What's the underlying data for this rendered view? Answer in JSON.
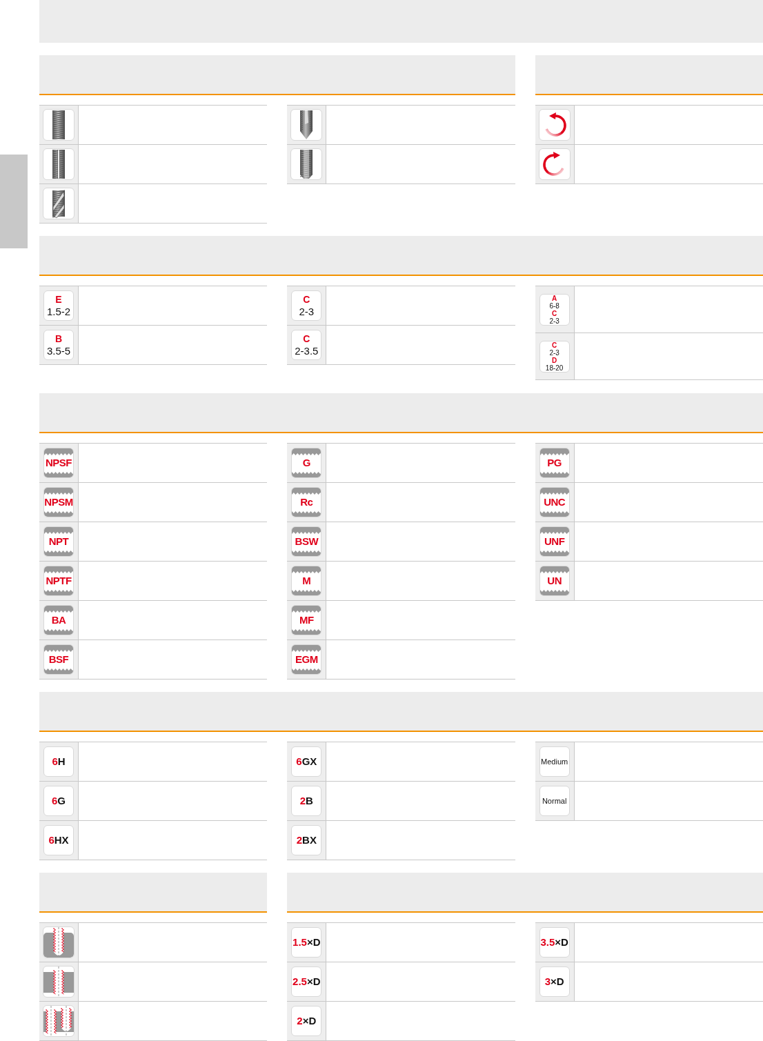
{
  "sections": [
    {
      "groups": [
        {
          "columns": [
            [
              {
                "kind": "straight"
              },
              {
                "kind": "fluted"
              },
              {
                "kind": "spiral"
              }
            ],
            [
              {
                "kind": "point"
              },
              {
                "kind": "forming"
              }
            ]
          ]
        },
        {
          "columns": [
            [
              {
                "kind": "ccw"
              },
              {
                "kind": "cw"
              }
            ]
          ]
        }
      ]
    },
    {
      "groups": [
        {
          "columns": [
            [
              {
                "kind": "chamfer",
                "lines": [
                  {
                    "text": "E",
                    "accent": true
                  },
                  {
                    "text": "1.5-2",
                    "accent": false
                  }
                ]
              },
              {
                "kind": "chamfer",
                "lines": [
                  {
                    "text": "B",
                    "accent": true
                  },
                  {
                    "text": "3.5-5",
                    "accent": false
                  }
                ]
              }
            ],
            [
              {
                "kind": "chamfer",
                "lines": [
                  {
                    "text": "C",
                    "accent": true
                  },
                  {
                    "text": "2-3",
                    "accent": false
                  }
                ]
              },
              {
                "kind": "chamfer",
                "lines": [
                  {
                    "text": "C",
                    "accent": true
                  },
                  {
                    "text": "2-3.5",
                    "accent": false
                  }
                ]
              }
            ],
            [
              {
                "kind": "chamfer2",
                "lines": [
                  {
                    "text": "A",
                    "accent": true
                  },
                  {
                    "text": "6-8",
                    "accent": false
                  },
                  {
                    "text": "C",
                    "accent": true
                  },
                  {
                    "text": "2-3",
                    "accent": false
                  }
                ]
              },
              {
                "kind": "chamfer2",
                "lines": [
                  {
                    "text": "C",
                    "accent": true
                  },
                  {
                    "text": "2-3",
                    "accent": false
                  },
                  {
                    "text": "D",
                    "accent": true
                  },
                  {
                    "text": "18-20",
                    "accent": false
                  }
                ]
              }
            ]
          ]
        }
      ]
    },
    {
      "groups": [
        {
          "columns": [
            [
              {
                "kind": "thread",
                "label": "NPSF"
              },
              {
                "kind": "thread",
                "label": "NPSM"
              },
              {
                "kind": "thread",
                "label": "NPT"
              },
              {
                "kind": "thread",
                "label": "NPTF"
              },
              {
                "kind": "thread",
                "label": "BA"
              },
              {
                "kind": "thread",
                "label": "BSF"
              }
            ],
            [
              {
                "kind": "thread",
                "label": "G"
              },
              {
                "kind": "thread",
                "label": "Rc"
              },
              {
                "kind": "thread",
                "label": "BSW"
              },
              {
                "kind": "thread",
                "label": "M"
              },
              {
                "kind": "thread",
                "label": "MF"
              },
              {
                "kind": "thread",
                "label": "EGM"
              }
            ],
            [
              {
                "kind": "thread",
                "label": "PG"
              },
              {
                "kind": "thread",
                "label": "UNC"
              },
              {
                "kind": "thread",
                "label": "UNF"
              },
              {
                "kind": "thread",
                "label": "UN"
              }
            ]
          ]
        }
      ]
    },
    {
      "groups": [
        {
          "columns": [
            [
              {
                "kind": "code",
                "parts": [
                  {
                    "text": "6",
                    "accent": true
                  },
                  {
                    "text": "H",
                    "accent": false
                  }
                ]
              },
              {
                "kind": "code",
                "parts": [
                  {
                    "text": "6",
                    "accent": true
                  },
                  {
                    "text": "G",
                    "accent": false
                  }
                ]
              },
              {
                "kind": "code",
                "parts": [
                  {
                    "text": "6",
                    "accent": true
                  },
                  {
                    "text": "HX",
                    "accent": false
                  }
                ]
              }
            ],
            [
              {
                "kind": "code",
                "parts": [
                  {
                    "text": "6",
                    "accent": true
                  },
                  {
                    "text": "GX",
                    "accent": false
                  }
                ]
              },
              {
                "kind": "code",
                "parts": [
                  {
                    "text": "2",
                    "accent": true
                  },
                  {
                    "text": "B",
                    "accent": false
                  }
                ]
              },
              {
                "kind": "code",
                "parts": [
                  {
                    "text": "2",
                    "accent": true
                  },
                  {
                    "text": "BX",
                    "accent": false
                  }
                ]
              }
            ],
            [
              {
                "kind": "word",
                "label": "Medium"
              },
              {
                "kind": "word",
                "label": "Normal"
              }
            ]
          ]
        }
      ]
    },
    {
      "groups": [
        {
          "columns": [
            [
              {
                "kind": "blind"
              },
              {
                "kind": "through"
              },
              {
                "kind": "both"
              }
            ]
          ]
        },
        {
          "columns": [
            [
              {
                "kind": "code",
                "parts": [
                  {
                    "text": "1.5",
                    "accent": true
                  },
                  {
                    "text": "×D",
                    "accent": false
                  }
                ]
              },
              {
                "kind": "code",
                "parts": [
                  {
                    "text": "2.5",
                    "accent": true
                  },
                  {
                    "text": "×D",
                    "accent": false
                  }
                ]
              },
              {
                "kind": "code",
                "parts": [
                  {
                    "text": "2",
                    "accent": true
                  },
                  {
                    "text": "×D",
                    "accent": false
                  }
                ]
              }
            ],
            [
              {
                "kind": "code",
                "parts": [
                  {
                    "text": "3.5",
                    "accent": true
                  },
                  {
                    "text": "×D",
                    "accent": false
                  }
                ]
              },
              {
                "kind": "code",
                "parts": [
                  {
                    "text": "3",
                    "accent": true
                  },
                  {
                    "text": "×D",
                    "accent": false
                  }
                ]
              }
            ]
          ]
        }
      ]
    }
  ]
}
